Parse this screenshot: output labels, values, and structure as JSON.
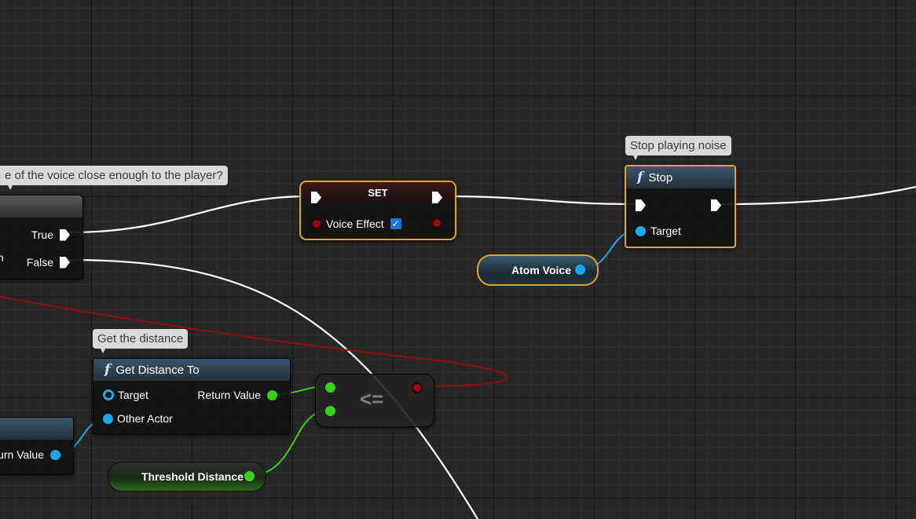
{
  "comments": {
    "branch": "e of the voice close enough to the player?",
    "stop": "Stop playing noise",
    "distance": "Get the distance"
  },
  "branch_node": {
    "true_label": "True",
    "false_label": "False",
    "left_edge_fragment": "n"
  },
  "set_node": {
    "title": "SET",
    "var_label": "Voice Effect",
    "checked": true,
    "check_glyph": "✓"
  },
  "stop_node": {
    "icon": "function-icon",
    "fn_glyph": "f",
    "title": "Stop",
    "target_label": "Target"
  },
  "atom_voice": {
    "label": "Atom Voice"
  },
  "get_distance": {
    "icon": "function-icon",
    "fn_glyph": "f",
    "title": "Get Distance To",
    "target_label": "Target",
    "other_actor_label": "Other Actor",
    "return_label": "Return Value"
  },
  "compare_node": {
    "op": "<="
  },
  "threshold": {
    "label": "Threshold Distance"
  },
  "left_getter": {
    "return_label": "urn Value"
  },
  "colors": {
    "exec": "#ffffff",
    "object": "#1aa7ec",
    "float": "#35d11b",
    "bool": "#8e0d0d",
    "selected_border": "#e3a520"
  }
}
